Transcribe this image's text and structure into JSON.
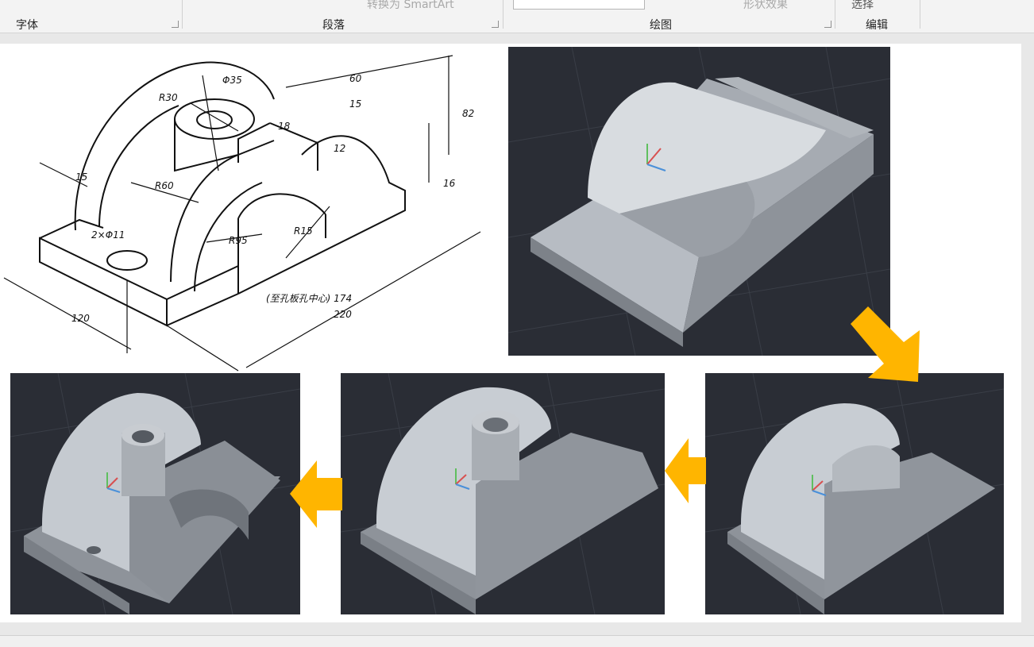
{
  "ribbon": {
    "groups": {
      "font": "字体",
      "paragraph": "段落",
      "drawing": "绘图",
      "editing": "编辑"
    },
    "paragraph_partial": "转换为 SmartArt",
    "drawing_partial": "形状效果",
    "editing_partial": "选择"
  },
  "drawing": {
    "dimensions": [
      "R30",
      "Φ35",
      "60",
      "15",
      "18",
      "82",
      "12",
      "16",
      "15",
      "R60",
      "R95",
      "R15",
      "2×Φ11",
      "120",
      "220",
      "(至孔板孔中心) 174"
    ]
  },
  "colors": {
    "accent_arrow": "#ffb500",
    "viewport_bg": "#2a2d35",
    "model_gray": "#9a9fa6"
  }
}
